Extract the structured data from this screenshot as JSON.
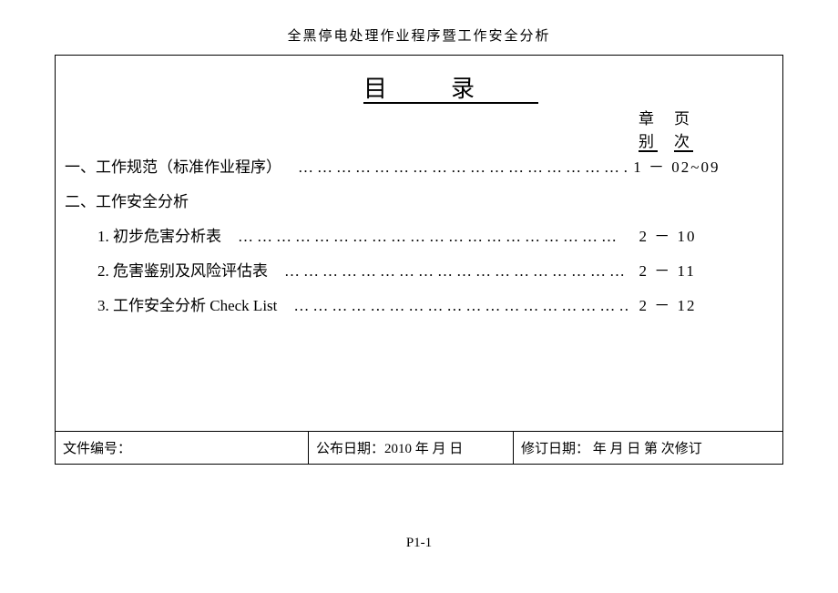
{
  "header_title": "全黑停电处理作业程序暨工作安全分析",
  "toc_title": "目录",
  "col_header": {
    "top_left": "章",
    "top_right": "页",
    "bot_left": "别",
    "bot_right": "次"
  },
  "entries": [
    {
      "label": "一、工作规范（标准作业程序）",
      "has_dots": true,
      "ref": " 1 － 02~09",
      "indent": 0
    },
    {
      "label": "二、工作安全分析",
      "has_dots": false,
      "ref": "",
      "indent": 0
    },
    {
      "label": "1. 初步危害分析表",
      "has_dots": true,
      "ref": "  2 － 10",
      "indent": 1
    },
    {
      "label": "2. 危害鉴别及风险评估表",
      "has_dots": true,
      "ref": "  2 － 11",
      "indent": 1
    },
    {
      "label": "3. 工作安全分析 Check List",
      "has_dots": true,
      "ref": "  2 － 12",
      "indent": 1
    }
  ],
  "dots_fill": "……………………………………………………",
  "footer": {
    "doc_no_label": "文件编号：",
    "publish": "公布日期：2010 年   月   日",
    "revise": "修订日期：      年   月   日   第     次修订"
  },
  "page_number": "P1-1"
}
